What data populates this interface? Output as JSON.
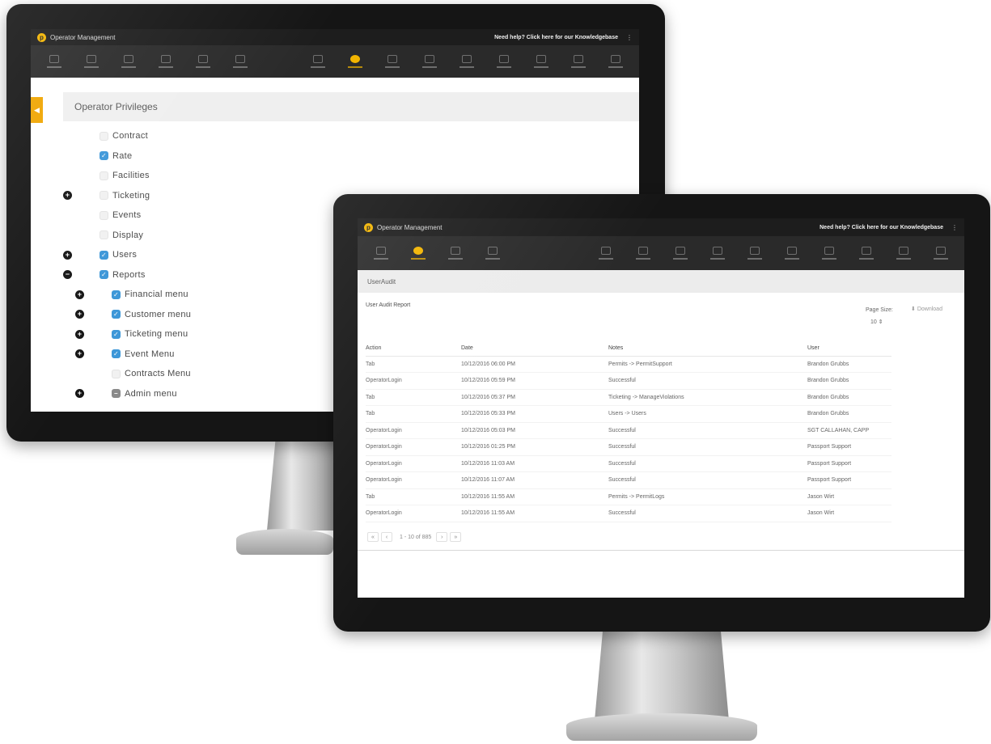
{
  "app": {
    "title": "Operator Management",
    "logo_letter": "p",
    "help_text": "Need help? Click here for our Knowledgebase",
    "more_icon": "vertical-ellipsis-icon",
    "accent": "#f2b400"
  },
  "privileges": {
    "title": "Operator Privileges",
    "side_tab_icon": "collapse-arrow-icon",
    "items": [
      {
        "label": "Contract",
        "checked": false,
        "expander": ""
      },
      {
        "label": "Rate",
        "checked": true,
        "expander": ""
      },
      {
        "label": "Facilities",
        "checked": false,
        "expander": ""
      },
      {
        "label": "Ticketing",
        "checked": false,
        "expander": "+"
      },
      {
        "label": "Events",
        "checked": false,
        "expander": ""
      },
      {
        "label": "Display",
        "checked": false,
        "expander": ""
      },
      {
        "label": "Users",
        "checked": true,
        "expander": "+"
      },
      {
        "label": "Reports",
        "checked": true,
        "expander": "−"
      },
      {
        "label": "Financial menu",
        "checked": true,
        "expander": "+"
      },
      {
        "label": "Customer menu",
        "checked": true,
        "expander": "+"
      },
      {
        "label": "Ticketing menu",
        "checked": true,
        "expander": "+"
      },
      {
        "label": "Event Menu",
        "checked": true,
        "expander": "+"
      },
      {
        "label": "Contracts Menu",
        "checked": false,
        "expander": ""
      },
      {
        "label": "Admin menu",
        "checked": "partial",
        "expander": "+"
      }
    ]
  },
  "audit": {
    "title": "UserAudit",
    "report_title": "User Audit Report",
    "page_size_label": "Page Size:",
    "page_size_value": "10",
    "download_label": "Download",
    "columns": [
      "Action",
      "Date",
      "Notes",
      "User"
    ],
    "rows": [
      [
        "Tab",
        "10/12/2016 06:00 PM",
        "Permits -> PermitSupport",
        "Brandon Grubbs"
      ],
      [
        "OperatorLogin",
        "10/12/2016 05:59 PM",
        "Successful",
        "Brandon Grubbs"
      ],
      [
        "Tab",
        "10/12/2016 05:37 PM",
        "Ticketing -> ManageViolations",
        "Brandon Grubbs"
      ],
      [
        "Tab",
        "10/12/2016 05:33 PM",
        "Users -> Users",
        "Brandon Grubbs"
      ],
      [
        "OperatorLogin",
        "10/12/2016 05:03 PM",
        "Successful",
        "SGT CALLAHAN, CAPP"
      ],
      [
        "OperatorLogin",
        "10/12/2016 01:25 PM",
        "Successful",
        "Passport Support"
      ],
      [
        "OperatorLogin",
        "10/12/2016 11:03 AM",
        "Successful",
        "Passport Support"
      ],
      [
        "OperatorLogin",
        "10/12/2016 11:07 AM",
        "Successful",
        "Passport Support"
      ],
      [
        "Tab",
        "10/12/2016 11:55 AM",
        "Permits -> PermitLogs",
        "Jason Wirt"
      ],
      [
        "OperatorLogin",
        "10/12/2016 11:55 AM",
        "Successful",
        "Jason Wirt"
      ]
    ],
    "pager": {
      "first": "«",
      "prev": "‹",
      "info": "1 - 10 of 885",
      "next": "›",
      "last": "»"
    }
  }
}
